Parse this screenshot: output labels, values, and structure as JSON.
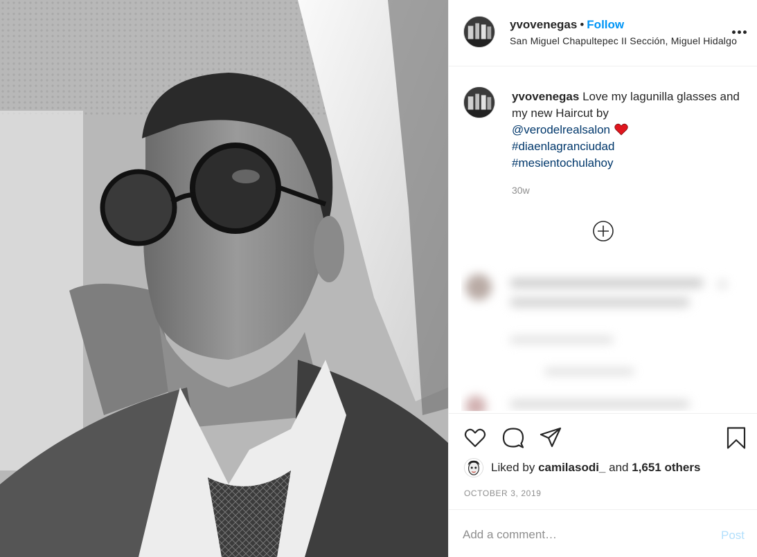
{
  "post": {
    "username": "yvovenegas",
    "separator": "•",
    "follow_label": "Follow",
    "location": "San Miguel Chapultepec II Sección, Miguel Hidalgo",
    "more_icon": "more-options-icon"
  },
  "caption": {
    "username": "yvovenegas",
    "text": "Love my lagunilla glasses and my new Haircut by",
    "mention": "@verodelrealsalon",
    "emoji": "red-heart",
    "hashtags": [
      "#diaenlagranciudad",
      "#mesientochulahoy"
    ],
    "age": "30w"
  },
  "actions": {
    "icons": [
      "heart-icon",
      "comment-icon",
      "share-icon",
      "bookmark-icon"
    ]
  },
  "likes": {
    "prefix": "Liked by",
    "user": "camilasodi_",
    "joiner": "and",
    "others": "1,651 others"
  },
  "date": "October 3, 2019",
  "comment_box": {
    "placeholder": "Add a comment…",
    "post_label": "Post"
  },
  "colors": {
    "link_blue": "#0095f6",
    "hashtag_blue": "#00376b",
    "muted_gray": "#8e8e8e",
    "border": "#efefef",
    "post_disabled": "#b2dffc"
  }
}
